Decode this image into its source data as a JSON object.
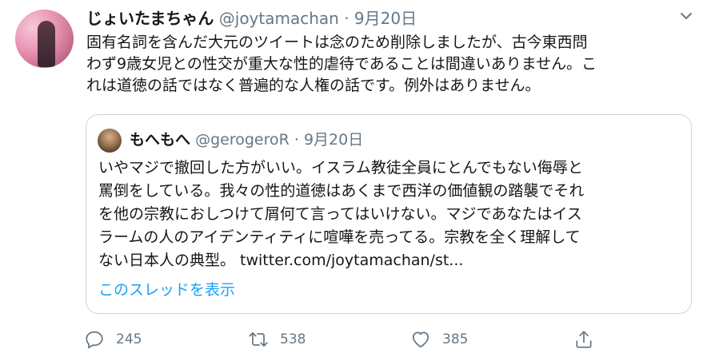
{
  "tweet": {
    "display_name": "じょいたまちゃん",
    "handle": "@joytamachan",
    "separator": "·",
    "date": "9月20日",
    "lines": [
      "固有名詞を含んだ大元のツイートは念のため削除しましたが、古今東西問",
      "わず9歳女児との性交が重大な性的虐待であることは間違いありません。こ",
      "れは道徳の話ではなく普遍的な人権の話です。例外はありません。"
    ]
  },
  "quoted": {
    "display_name": "もへもへ",
    "handle": "@gerogeroR",
    "separator": "·",
    "date": "9月20日",
    "lines": [
      "いやマジで撤回した方がいい。イスラム教徒全員にとんでもない侮辱と",
      "罵倒をしている。我々の性的道徳はあくまで西洋の価値観の踏襲でそれ",
      "を他の宗教におしつけて屑何て言ってはいけない。マジであなたはイス",
      "ラームの人のアイデンティティに喧嘩を売ってる。宗教を全く理解して",
      "ない日本人の典型。 twitter.com/joytamachan/st..."
    ],
    "show_thread": "このスレッドを表示"
  },
  "actions": {
    "reply_count": "245",
    "retweet_count": "538",
    "like_count": "385"
  },
  "colors": {
    "link": "#1da1f2",
    "muted": "#657786",
    "border": "#ccd6dd"
  }
}
